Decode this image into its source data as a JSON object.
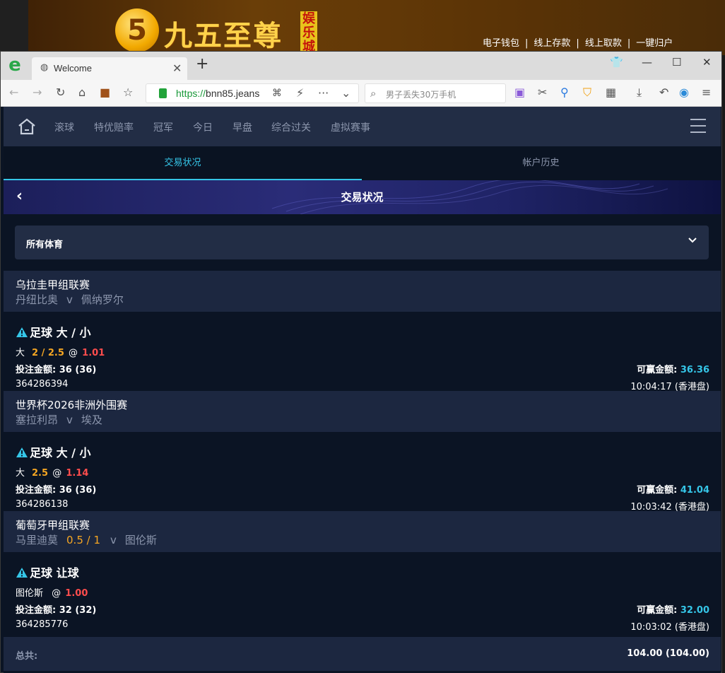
{
  "site": {
    "logo_number": "5",
    "logo_text": "九五至尊",
    "logo_badge": [
      "娱",
      "乐",
      "城"
    ],
    "links": [
      "电子钱包",
      "线上存款",
      "线上取款",
      "一键归户"
    ]
  },
  "browser": {
    "tab_title": "Welcome",
    "url_scheme": "https://",
    "url_host": "bnn85.jeans",
    "search_placeholder": "男子丢失30万手机"
  },
  "nav": {
    "items": [
      "滚球",
      "特优赔率",
      "冠军",
      "今日",
      "早盘",
      "综合过关",
      "虚拟赛事"
    ]
  },
  "subtabs": {
    "active": "交易状况",
    "inactive": "帐户历史"
  },
  "hero_title": "交易状况",
  "filter": {
    "selected": "所有体育"
  },
  "labels": {
    "stake": "投注金额:",
    "win": "可赢金额:",
    "at": "@",
    "vs": "v"
  },
  "bets": [
    {
      "league": "乌拉圭甲组联赛",
      "home": "丹纽比奥",
      "handicap": "",
      "away": "佩纳罗尔",
      "bet_type": "足球 大 / 小",
      "selection": "大",
      "line": "2 / 2.5",
      "odds": "1.01",
      "stake": "36 (36)",
      "potential_win": "36.36",
      "ticket_id": "364286394",
      "time": "10:04:17 (香港盘)"
    },
    {
      "league": "世界杯2026非洲外围赛",
      "home": "塞拉利昂",
      "handicap": "",
      "away": "埃及",
      "bet_type": "足球 大 / 小",
      "selection": "大",
      "line": "2.5",
      "odds": "1.14",
      "stake": "36 (36)",
      "potential_win": "41.04",
      "ticket_id": "364286138",
      "time": "10:03:42 (香港盘)"
    },
    {
      "league": "葡萄牙甲组联赛",
      "home": "马里迪莫",
      "handicap": "0.5 / 1",
      "away": "图伦斯",
      "bet_type": "足球 让球",
      "selection": "图伦斯",
      "line": "",
      "odds": "1.00",
      "stake": "32 (32)",
      "potential_win": "32.00",
      "ticket_id": "364285776",
      "time": "10:03:02 (香港盘)"
    }
  ],
  "total": {
    "label": "总共:",
    "value": "104.00 (104.00)"
  },
  "colors": {
    "accent": "#35c6e8",
    "odds": "#ff4d4d",
    "line": "#f5a623",
    "panel": "#1c2740",
    "bg": "#0b1424"
  }
}
